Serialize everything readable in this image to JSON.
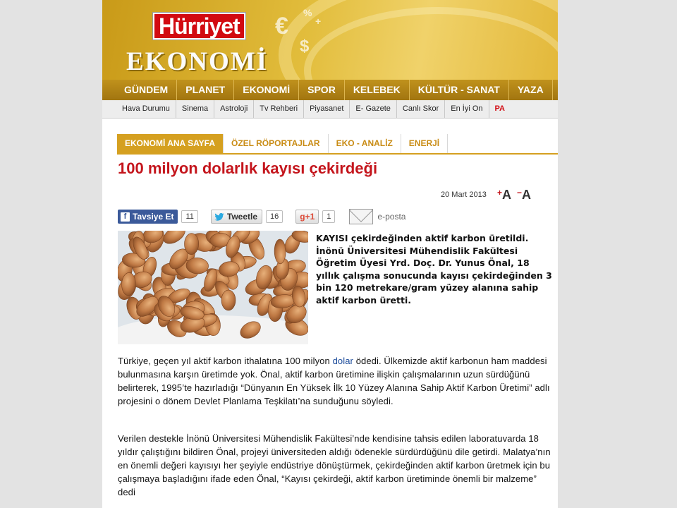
{
  "brand": {
    "logo": "Hürriyet",
    "section": "EKONOMİ",
    "currency_symbols": [
      "€",
      "$",
      "%",
      "+"
    ]
  },
  "main_nav": [
    "GÜNDEM",
    "PLANET",
    "EKONOMİ",
    "SPOR",
    "KELEBEK",
    "KÜLTÜR - SANAT",
    "YAZA"
  ],
  "sub_nav": [
    "Hava Durumu",
    "Sinema",
    "Astroloji",
    "Tv Rehberi",
    "Piyasanet",
    "E- Gazete",
    "Canlı Skor",
    "En İyi On"
  ],
  "sub_nav_extra": "PA",
  "section_tabs": [
    "EKONOMİ ANA SAYFA",
    "ÖZEL RÖPORTAJLAR",
    "EKO - ANALİZ",
    "ENERJİ"
  ],
  "active_tab": "EKONOMİ ANA SAYFA",
  "article": {
    "title": "100 milyon dolarlık kayısı çekirdeği",
    "date": "20 Mart 2013",
    "font_increase": "A",
    "font_decrease": "A",
    "lead": "KAYISI çekirdeğinden aktif karbon üretildi. İnönü Üniversitesi Mühendislik Fakültesi Öğretim Üyesi Yrd. Doç. Dr. Yunus Önal, 18 yıllık çalışma sonucunda kayısı çekirdeğinden 3 bin 120 metrekare/gram yüzey alanına sahip aktif karbon üretti.",
    "p1_before": "Türkiye, geçen yıl aktif karbon ithalatına 100 milyon ",
    "p1_link": "dolar",
    "p1_after": " ödedi. Ülkemizde aktif karbonun ham maddesi bulunmasına karşın üretimde yok. Önal, aktif karbon üretimine ilişkin çalışmalarının uzun sürdüğünü belirterek, 1995’te hazırladığı “Dünyanın En Yüksek İlk 10 Yüzey Alanına Sahip Aktif Karbon Üretimi” adlı projesini o dönem Devlet Planlama Teşkilatı’na sunduğunu söyledi.",
    "p2": "Verilen destekle İnönü Üniversitesi Mühendislik Fakültesi’nde kendisine tahsis edilen laboratuvarda 18 yıldır çalıştığını bildiren Önal, projeyi üniversiteden aldığı ödenekle sürdürdüğünü dile getirdi. Malatya’nın en önemli değeri kayısıyı her şeyiyle endüstriye dönüştürmek, çekirdeğinden aktif karbon üretmek için bu çalışmaya başladığını ifade eden Önal, “Kayısı çekirdeği, aktif karbon üretiminde önemli bir malzeme” dedi"
  },
  "share": {
    "facebook_label": "Tavsiye Et",
    "facebook_icon": "f",
    "facebook_count": "11",
    "twitter_label": "Tweetle",
    "twitter_count": "16",
    "gplus_label": "g+1",
    "gplus_count": "1",
    "email_label": "e-posta"
  },
  "colors": {
    "accent_red": "#c4151c",
    "gold": "#d5a020",
    "facebook_blue": "#3b5a9a"
  }
}
